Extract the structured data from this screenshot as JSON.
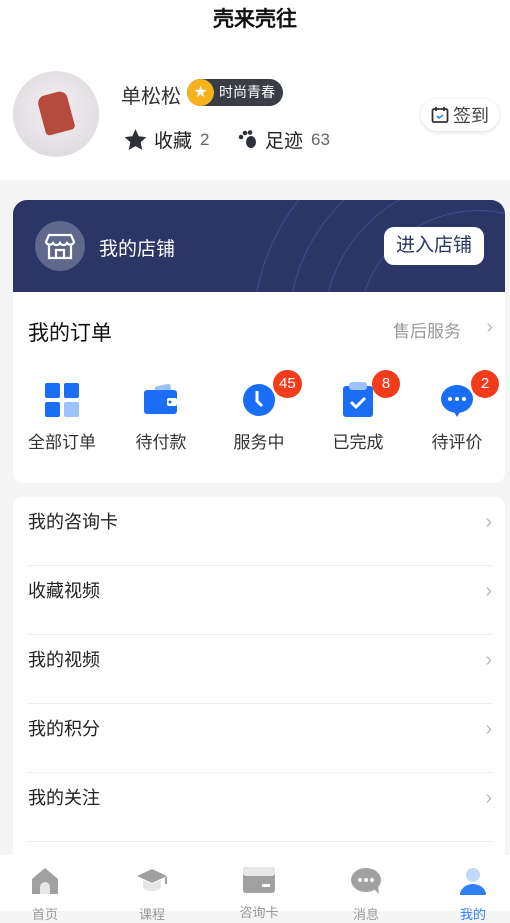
{
  "header": {
    "title": "壳来壳往"
  },
  "profile": {
    "name": "单松松",
    "level_badge": "时尚青春",
    "favorites_label": "收藏",
    "favorites_count": "2",
    "footprints_label": "足迹",
    "footprints_count": "63",
    "signin_label": "签到"
  },
  "store": {
    "label": "我的店铺",
    "enter_label": "进入店铺"
  },
  "orders": {
    "title": "我的订单",
    "after_sale": "售后服务",
    "items": [
      {
        "label": "全部订单",
        "icon": "grid-icon",
        "badge": null
      },
      {
        "label": "待付款",
        "icon": "wallet-icon",
        "badge": null
      },
      {
        "label": "服务中",
        "icon": "clock-icon",
        "badge": "45"
      },
      {
        "label": "已完成",
        "icon": "clipboard-check-icon",
        "badge": "8"
      },
      {
        "label": "待评价",
        "icon": "chat-bubble-icon",
        "badge": "2"
      }
    ]
  },
  "menu": {
    "items": [
      {
        "label": "我的咨询卡"
      },
      {
        "label": "收藏视频"
      },
      {
        "label": "我的视频"
      },
      {
        "label": "我的积分"
      },
      {
        "label": "我的关注"
      }
    ]
  },
  "tabbar": {
    "items": [
      {
        "label": "首页",
        "icon": "home-icon"
      },
      {
        "label": "课程",
        "icon": "graduation-cap-icon"
      },
      {
        "label": "咨询卡",
        "icon": "card-icon"
      },
      {
        "label": "消息",
        "icon": "message-icon"
      },
      {
        "label": "我的",
        "icon": "user-icon",
        "active": true
      }
    ]
  },
  "colors": {
    "accent": "#1a6ef5",
    "store_bg": "#2b3666",
    "badge_red": "#f43c1c",
    "tab_active": "#2f80f7",
    "tab_inactive": "#a0a0a0"
  }
}
